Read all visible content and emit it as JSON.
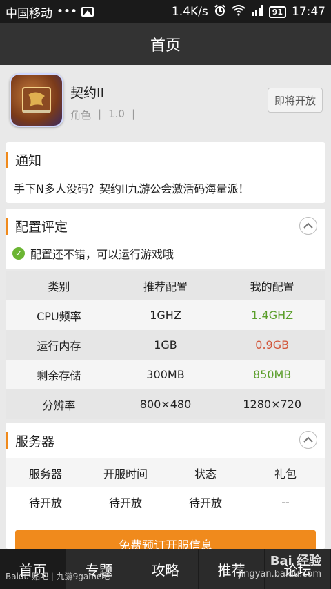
{
  "status_bar": {
    "carrier": "中国移动",
    "dots": "•••",
    "speed": "1.4K/s",
    "battery": "91",
    "time": "17:47"
  },
  "title_bar": {
    "title": "首页"
  },
  "app": {
    "name": "契约II",
    "category": "角色",
    "separator": "|",
    "version": "1.0",
    "separator2": "|",
    "status_button": "即将开放"
  },
  "notice": {
    "title": "通知",
    "text": "手下N多人没码？契约II九游公会激活码海量派！"
  },
  "config": {
    "title": "配置评定",
    "result": "配置还不错，可以运行游戏哦",
    "headers": [
      "类别",
      "推荐配置",
      "我的配置"
    ],
    "rows": [
      {
        "category": "CPU频率",
        "recommended": "1GHZ",
        "mine": "1.4GHZ",
        "mine_status": "good"
      },
      {
        "category": "运行内存",
        "recommended": "1GB",
        "mine": "0.9GB",
        "mine_status": "bad"
      },
      {
        "category": "剩余存储",
        "recommended": "300MB",
        "mine": "850MB",
        "mine_status": "good"
      },
      {
        "category": "分辨率",
        "recommended": "800×480",
        "mine": "1280×720",
        "mine_status": "neutral"
      }
    ],
    "colors": {
      "good": "#5a9e2a",
      "bad": "#d2563a",
      "accent": "#f08a1c"
    }
  },
  "server": {
    "title": "服务器",
    "headers": [
      "服务器",
      "开服时间",
      "状态",
      "礼包"
    ],
    "rows": [
      [
        "待开放",
        "待开放",
        "待开放",
        "--"
      ]
    ],
    "button": "免费预订开服信息"
  },
  "bottom_nav": {
    "items": [
      "首页",
      "专题",
      "攻略",
      "推荐",
      "论坛"
    ],
    "active_index": 0
  },
  "watermarks": {
    "left": "Baidu 贴吧 | 九游9game吧",
    "right_top": "Bai 经验",
    "right_bottom": "jingyan.baidu.com"
  }
}
